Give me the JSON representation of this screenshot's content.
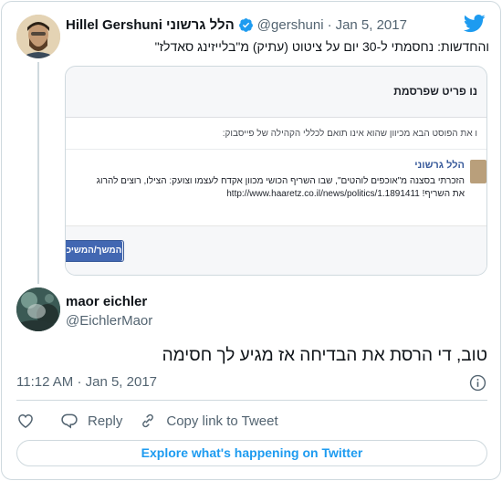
{
  "parent_tweet": {
    "display_name": "Hillel Gershuni הלל גרשוני",
    "handle": "@gershuni",
    "separator": "·",
    "date": "Jan 5, 2017",
    "text": "והחדשות: נחסמתי ל-30 יום על ציטוט (עתיק) מ\"בלייזינג סאדלז\"",
    "screenshot": {
      "title": "נו פריט שפרסמת",
      "note": "ו את הפוסט הבא מכיוון שהוא אינו תואם לכללי הקהילה של פייסבוק:",
      "post_author": "הלל גרשוני",
      "post_line1": "הזכרתי בסצנה מ\"אוכפים לוהטים\", שבו השריף הכושי מכוון אקדח לעצמו וצועק: הצילו, רוצים להרוג",
      "post_line2_text": "את השריף!",
      "post_url": "http://www.haaretz.co.il/news/politics/1.1891411",
      "button_label": "המשך/המשיכ"
    }
  },
  "tweet": {
    "display_name": "maor eichler",
    "handle": "@EichlerMaor",
    "text": "טוב, די הרסת את הבדיחה אז מגיע לך חסימה",
    "time": "11:12 AM",
    "separator": "·",
    "date": "Jan 5, 2017"
  },
  "actions": {
    "reply": "Reply",
    "copy_link": "Copy link to Tweet"
  },
  "explore_label": "Explore what's happening on Twitter",
  "colors": {
    "twitter_blue": "#1d9bf0",
    "text_secondary": "#536471",
    "border": "#cfd9de",
    "facebook_blue": "#4267b2"
  },
  "icons": [
    "twitter-logo-icon",
    "verified-badge-icon",
    "info-icon",
    "heart-icon",
    "reply-icon",
    "link-icon"
  ]
}
